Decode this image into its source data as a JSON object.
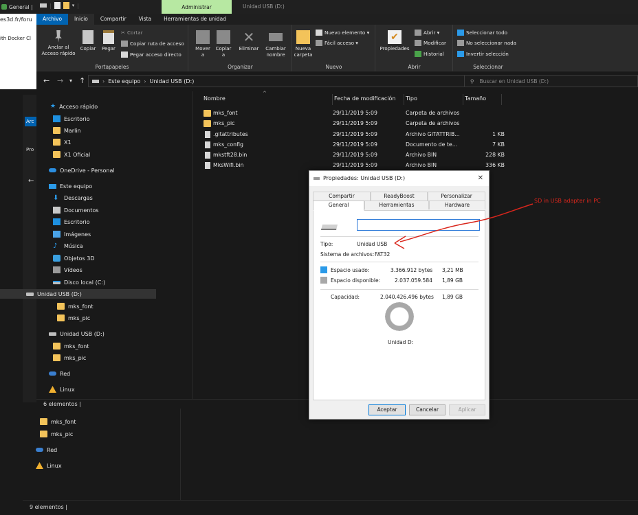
{
  "browser": {
    "tab_label": "General |",
    "site_text": "es3d.fr/foru",
    "docker_text": "ith Docker Cl"
  },
  "titlebar": {
    "context_tab": "Administrar",
    "window_title": "Unidad USB (D:)"
  },
  "menu": {
    "items": [
      "Archivo",
      "Inicio",
      "Compartir",
      "Vista",
      "Herramientas de unidad"
    ]
  },
  "ribbon": {
    "groups": {
      "portapapeles": "Portapapeles",
      "organizar": "Organizar",
      "nuevo": "Nuevo",
      "abrir": "Abrir",
      "seleccionar": "Seleccionar"
    },
    "anclar": "Anclar al Acceso rápido",
    "copiar": "Copiar",
    "pegar": "Pegar",
    "cortar": "Cortar",
    "copiar_ruta": "Copiar ruta de acceso",
    "pegar_acceso": "Pegar acceso directo",
    "mover": "Mover a",
    "copiar_a": "Copiar a",
    "eliminar": "Eliminar",
    "cambiar_nombre": "Cambiar nombre",
    "nueva_carpeta": "Nueva carpeta",
    "nuevo_elemento": "Nuevo elemento ▾",
    "facil_acceso": "Fácil acceso ▾",
    "propiedades": "Propiedades",
    "abrir_btn": "Abrir ▾",
    "modificar": "Modificar",
    "historial": "Historial",
    "seleccionar_todo": "Seleccionar todo",
    "no_seleccionar": "No seleccionar nada",
    "invertir": "Invertir selección"
  },
  "address": {
    "crumb_1": "Este equipo",
    "crumb_2": "Unidad USB (D:)",
    "search_placeholder": "Buscar en Unidad USB (D:)"
  },
  "nav_pane": {
    "items": [
      "Acceso rápido",
      "Escritorio",
      "Marlin",
      "X1",
      "X1 Oficial",
      "OneDrive - Personal",
      "Este equipo",
      "Descargas",
      "Documentos",
      "Escritorio",
      "Imágenes",
      "Música",
      "Objetos 3D",
      "Vídeos",
      "Disco local (C:)",
      "Unidad USB (D:)",
      "mks_font",
      "mks_pic",
      "Unidad USB (D:)",
      "mks_font",
      "mks_pic",
      "Red",
      "Linux"
    ]
  },
  "columns": {
    "name": "Nombre",
    "date": "Fecha de modificación",
    "type": "Tipo",
    "size": "Tamaño"
  },
  "files": [
    {
      "name": "mks_font",
      "date": "29/11/2019 5:09",
      "type": "Carpeta de archivos",
      "size": ""
    },
    {
      "name": "mks_pic",
      "date": "29/11/2019 5:09",
      "type": "Carpeta de archivos",
      "size": ""
    },
    {
      "name": ".gitattributes",
      "date": "29/11/2019 5:09",
      "type": "Archivo GITATTRIB...",
      "size": "1 KB"
    },
    {
      "name": "mks_config",
      "date": "29/11/2019 5:09",
      "type": "Documento de te...",
      "size": "7 KB"
    },
    {
      "name": "mkstft28.bin",
      "date": "29/11/2019 5:09",
      "type": "Archivo BIN",
      "size": "228 KB"
    },
    {
      "name": "MksWifi.bin",
      "date": "29/11/2019 5:09",
      "type": "Archivo BIN",
      "size": "336 KB"
    }
  ],
  "status": {
    "main": "6 elementos  |",
    "background": "9 elementos  |"
  },
  "bg_nav": {
    "items": [
      "mks_font",
      "mks_pic",
      "Red",
      "Linux"
    ],
    "top_left": "Arc",
    "pro": "Pro"
  },
  "dialog": {
    "title": "Propiedades: Unidad USB (D:)",
    "tabs_top": [
      "Compartir",
      "ReadyBoost",
      "Personalizar"
    ],
    "tabs_bottom": [
      "General",
      "Herramientas",
      "Hardware"
    ],
    "name_value": "",
    "tipo_label": "Tipo:",
    "tipo_value": "Unidad USB",
    "fs_label": "Sistema de archivos:",
    "fs_value": "FAT32",
    "used_label": "Espacio usado:",
    "used_bytes": "3.366.912 bytes",
    "used_human": "3,21 MB",
    "free_label": "Espacio disponible:",
    "free_bytes": "2.037.059.584",
    "free_human": "1,89 GB",
    "cap_label": "Capacidad:",
    "cap_bytes": "2.040.426.496 bytes",
    "cap_human": "1,89 GB",
    "drive_label": "Unidad D:",
    "used_fraction": 0.00165,
    "buttons": {
      "ok": "Aceptar",
      "cancel": "Cancelar",
      "apply": "Aplicar"
    },
    "colors": {
      "used": "#2b9ae8",
      "free": "#a8a8a8"
    }
  },
  "annotation": {
    "text": "SD in USB adapter in PC",
    "color": "#d9261c"
  }
}
